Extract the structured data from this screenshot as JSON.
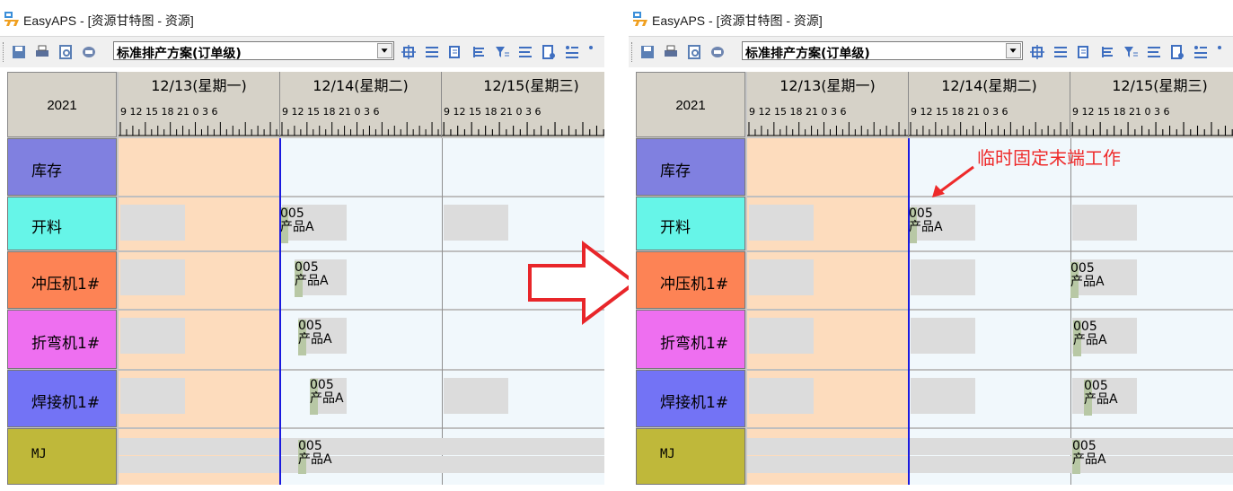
{
  "window": {
    "title": "EasyAPS - [资源甘特图 - 资源]"
  },
  "toolbar": {
    "scheme_select": "标准排产方案(订单级)"
  },
  "gantt": {
    "year": "2021",
    "days": [
      "12/13(星期一)",
      "12/14(星期二)",
      "12/15(星期三)"
    ],
    "hours": "9  12  15  18  21   0   3   6",
    "resources": [
      "库存",
      "开料",
      "冲压机1#",
      "折弯机1#",
      "焊接机1#",
      "MJ"
    ],
    "resource_colors": [
      "#8080e0",
      "#66f5e8",
      "#fd8355",
      "#ee6ff0",
      "#7373f5",
      "#bfb83a"
    ],
    "job": {
      "order": "005",
      "product": "产品A"
    }
  },
  "annotation": {
    "text": "临时固定末端工作"
  }
}
